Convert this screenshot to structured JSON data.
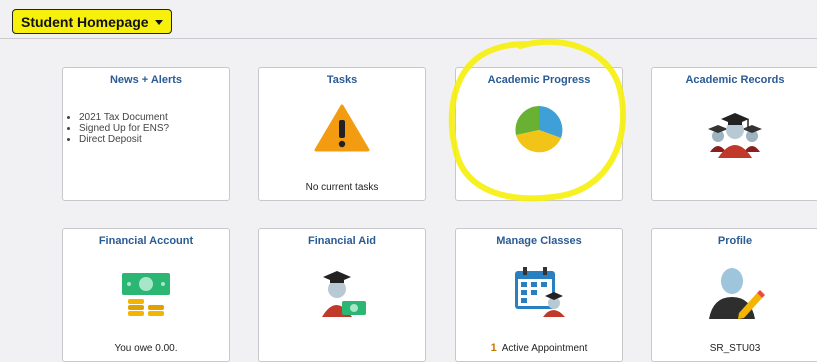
{
  "header": {
    "title": "Student Homepage"
  },
  "tiles": {
    "news": {
      "title": "News + Alerts",
      "items": [
        "2021 Tax Document",
        "Signed Up for ENS?",
        "Direct Deposit"
      ]
    },
    "tasks": {
      "title": "Tasks",
      "footer": "No current tasks"
    },
    "academic_progress": {
      "title": "Academic Progress"
    },
    "academic_records": {
      "title": "Academic Records"
    },
    "financial_account": {
      "title": "Financial Account",
      "footer": "You owe 0.00."
    },
    "financial_aid": {
      "title": "Financial Aid"
    },
    "manage_classes": {
      "title": "Manage Classes",
      "count": "1",
      "footer": "Active Appointment"
    },
    "profile": {
      "title": "Profile",
      "footer": "SR_STU03"
    }
  },
  "colors": {
    "highlight": "#f6f00c",
    "title_blue": "#2a5b94",
    "warning_orange": "#f39c12",
    "pie_blue": "#3fa0d8",
    "pie_yellow": "#f2c418",
    "pie_green": "#69b133",
    "grad_red": "#c0392b",
    "money_green": "#2bb673",
    "coin_gold": "#f4b400"
  }
}
